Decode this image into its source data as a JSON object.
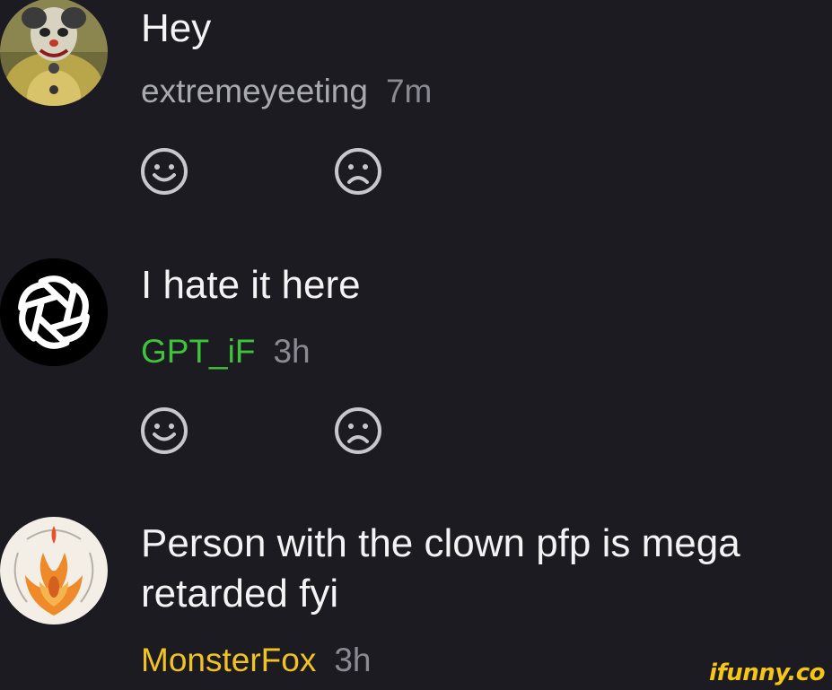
{
  "comments": [
    {
      "text": "Hey",
      "username": "extremeyeeting",
      "username_color": "#a9a9b0",
      "time": "7m",
      "avatar": "clown-avatar"
    },
    {
      "text": "I hate it here",
      "username": "GPT_iF",
      "username_color": "#3fc33a",
      "time": "3h",
      "avatar": "openai-logo-avatar"
    },
    {
      "text_line1": "Person with the clown pfp is mega",
      "text_line2": "retarded fyi",
      "username": "MonsterFox",
      "username_color": "#f0c322",
      "time": "3h",
      "avatar": "nine-tailed-fox-avatar"
    }
  ],
  "icons": {
    "like": "smile-icon",
    "dislike": "frown-icon"
  },
  "watermark": "ifunny.co",
  "colors": {
    "background": "#1c1b22",
    "text": "#f3f3f5",
    "muted": "#8a8a92",
    "icon": "#c8c8cc",
    "watermark": "#f5c518"
  }
}
